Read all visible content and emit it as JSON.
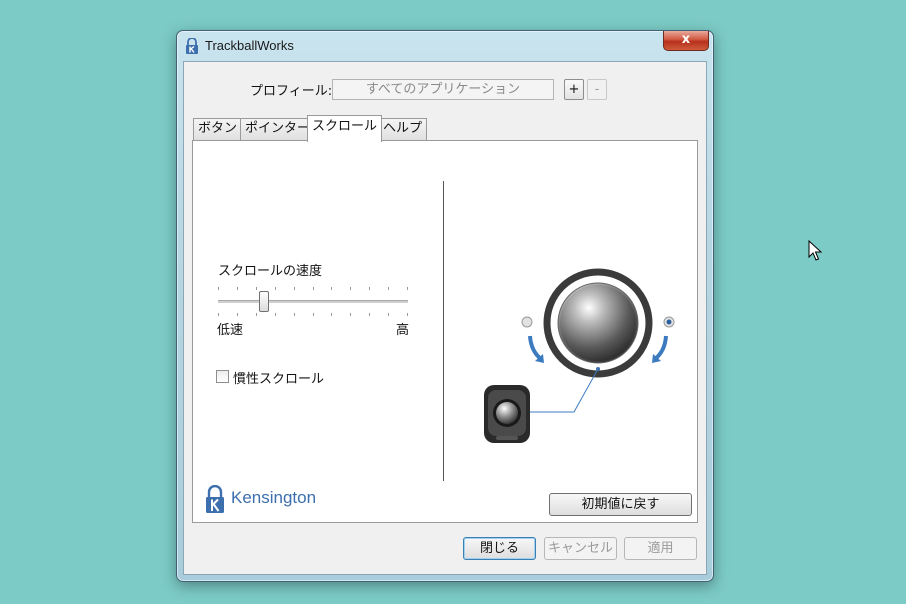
{
  "window": {
    "title": "TrackballWorks",
    "close_label": "x"
  },
  "profile": {
    "label": "プロフィール:",
    "value": "すべてのアプリケーション",
    "add_label": "+",
    "remove_label": "-"
  },
  "tabs": [
    {
      "label": "ボタン",
      "active": false
    },
    {
      "label": "ポインター",
      "active": false
    },
    {
      "label": "スクロール",
      "active": true
    },
    {
      "label": "ヘルプ",
      "active": false
    }
  ],
  "scroll": {
    "speed_title": "スクロールの速度",
    "speed_level": 0.24,
    "tick_count": 11,
    "low_label": "低速",
    "high_label": "高",
    "inertia_label": "慣性スクロール",
    "inertia_checked": false
  },
  "illustration": {
    "left_direction_selected": false,
    "right_direction_selected": true
  },
  "brand": {
    "name": "Kensington",
    "color": "#3d6fae"
  },
  "buttons": {
    "reset": "初期値に戻す",
    "close": "閉じる",
    "cancel": "キャンセル",
    "apply": "適用"
  }
}
